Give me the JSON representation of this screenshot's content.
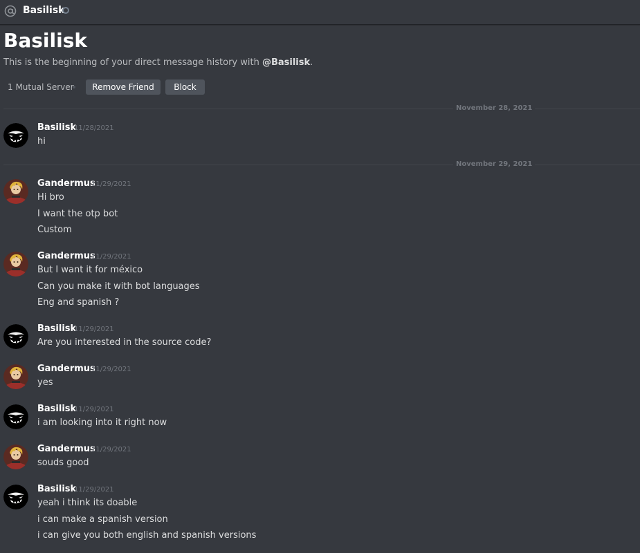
{
  "topbar": {
    "icon": "at-icon",
    "name": "Basilisk",
    "status": "offline"
  },
  "header": {
    "title": "Basilisk",
    "subtitle_prefix": "This is the beginning of your direct message history with ",
    "subtitle_handle": "@Basilisk",
    "subtitle_suffix": ".",
    "mutual_servers": "1 Mutual Server",
    "remove_friend_label": "Remove Friend",
    "block_label": "Block"
  },
  "colors": {
    "background": "#36393f",
    "button": "#4f545c",
    "muted_text": "#72767d",
    "message_text": "#dcddde"
  },
  "dividers": [
    {
      "label": "November 28, 2021"
    },
    {
      "label": "November 29, 2021"
    }
  ],
  "messages": [
    {
      "author": "Basilisk",
      "timestamp": "11/28/2021",
      "avatar": "basilisk-avatar",
      "lines": [
        "hi"
      ]
    },
    {
      "author": "Gandermus",
      "timestamp": "11/29/2021",
      "avatar": "gandermus-avatar",
      "lines": [
        "Hi bro",
        "I want the otp bot",
        "Custom"
      ]
    },
    {
      "author": "Gandermus",
      "timestamp": "11/29/2021",
      "avatar": "gandermus-avatar",
      "lines": [
        "But I want it for méxico",
        "Can you make it with bot languages",
        "Eng and spanish ?"
      ]
    },
    {
      "author": "Basilisk",
      "timestamp": "11/29/2021",
      "avatar": "basilisk-avatar",
      "lines": [
        "Are you interested in the source code?"
      ]
    },
    {
      "author": "Gandermus",
      "timestamp": "11/29/2021",
      "avatar": "gandermus-avatar",
      "lines": [
        "yes"
      ]
    },
    {
      "author": "Basilisk",
      "timestamp": "11/29/2021",
      "avatar": "basilisk-avatar",
      "lines": [
        "i am looking into it right now"
      ]
    },
    {
      "author": "Gandermus",
      "timestamp": "11/29/2021",
      "avatar": "gandermus-avatar",
      "lines": [
        "souds good"
      ]
    },
    {
      "author": "Basilisk",
      "timestamp": "11/29/2021",
      "avatar": "basilisk-avatar",
      "lines": [
        "yeah i think its doable",
        "i can make a spanish version",
        "i can give you both english and spanish versions"
      ]
    }
  ]
}
